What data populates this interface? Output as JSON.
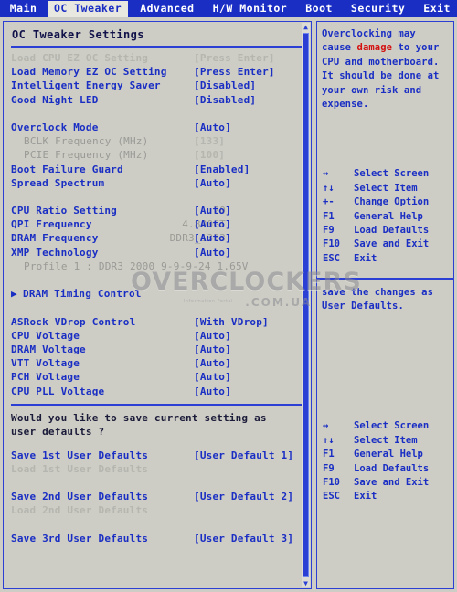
{
  "menu": {
    "tabs": [
      {
        "label": "Main",
        "active": false
      },
      {
        "label": "OC Tweaker",
        "active": true
      },
      {
        "label": "Advanced",
        "active": false
      },
      {
        "label": "H/W Monitor",
        "active": false
      },
      {
        "label": "Boot",
        "active": false
      },
      {
        "label": "Security",
        "active": false
      },
      {
        "label": "Exit",
        "active": false
      }
    ]
  },
  "panel": {
    "title": "OC Tweaker Settings",
    "question_line1": "Would you like to save current setting as",
    "question_line2": "user defaults ?"
  },
  "settings": [
    {
      "label": "Load CPU EZ OC Setting",
      "mid": "",
      "value": "[Press Enter]",
      "dim": true,
      "indent": false
    },
    {
      "label": "Load Memory EZ OC Setting",
      "mid": "",
      "value": "[Press Enter]",
      "dim": false,
      "indent": false
    },
    {
      "label": "Intelligent Energy Saver",
      "mid": "",
      "value": "[Disabled]",
      "dim": false,
      "indent": false
    },
    {
      "label": "Good Night LED",
      "mid": "",
      "value": "[Disabled]",
      "dim": false,
      "indent": false
    },
    {
      "gap": true
    },
    {
      "label": "Overclock Mode",
      "mid": "",
      "value": "[Auto]",
      "dim": false,
      "indent": false
    },
    {
      "label": "BCLK Frequency (MHz)",
      "mid": "",
      "value": "[133]",
      "dim": true,
      "indent": true
    },
    {
      "label": "PCIE Frequency (MHz)",
      "mid": "",
      "value": "[100]",
      "dim": true,
      "indent": true
    },
    {
      "label": "Boot Failure Guard",
      "mid": "",
      "value": "[Enabled]",
      "dim": false,
      "indent": false
    },
    {
      "label": "Spread Spectrum",
      "mid": "",
      "value": "[Auto]",
      "dim": false,
      "indent": false
    },
    {
      "gap": true
    },
    {
      "label": "CPU Ratio Setting",
      "mid": "20",
      "value": "[Auto]",
      "dim": false,
      "indent": false
    },
    {
      "label": "QPI Frequency",
      "mid": "4.800GT",
      "value": "[Auto]",
      "dim": false,
      "indent": false
    },
    {
      "label": "DRAM Frequency",
      "mid": "DDR3_1333",
      "value": "[Auto]",
      "dim": false,
      "indent": false
    },
    {
      "label": "XMP Technology",
      "mid": "",
      "value": "[Auto]",
      "dim": false,
      "indent": false
    },
    {
      "label": "Profile 1 : DDR3 2000 9-9-9-24 1.65V",
      "mid": "",
      "value": "",
      "dim": true,
      "indent": true
    },
    {
      "gap": true
    },
    {
      "label": "DRAM Timing Control",
      "mid": "",
      "value": "",
      "dim": false,
      "indent": false,
      "submenu": true
    },
    {
      "gap": true
    },
    {
      "label": "ASRock VDrop Control",
      "mid": "",
      "value": "[With VDrop]",
      "dim": false,
      "indent": false
    },
    {
      "label": "CPU Voltage",
      "mid": "",
      "value": "[Auto]",
      "dim": false,
      "indent": false
    },
    {
      "label": "DRAM Voltage",
      "mid": "",
      "value": "[Auto]",
      "dim": false,
      "indent": false
    },
    {
      "label": "VTT Voltage",
      "mid": "",
      "value": "[Auto]",
      "dim": false,
      "indent": false
    },
    {
      "label": "PCH Voltage",
      "mid": "",
      "value": "[Auto]",
      "dim": false,
      "indent": false
    },
    {
      "label": "CPU PLL Voltage",
      "mid": "",
      "value": "[Auto]",
      "dim": false,
      "indent": false
    }
  ],
  "defaults_rows": [
    {
      "label": "Save 1st User Defaults",
      "value": "[User Default  1]",
      "dim": false
    },
    {
      "label": "Load 1st User Defaults",
      "value": "",
      "dim": true
    },
    {
      "gap": true
    },
    {
      "label": "Save 2nd User Defaults",
      "value": "[User Default  2]",
      "dim": false
    },
    {
      "label": "Load 2nd User Defaults",
      "value": "",
      "dim": true
    },
    {
      "gap": true
    },
    {
      "label": "Save 3rd User Defaults",
      "value": "[User Default  3]",
      "dim": false
    }
  ],
  "help": {
    "warning_parts": [
      {
        "text": "Overclocking may cause ",
        "danger": false
      },
      {
        "text": "damage",
        "danger": true
      },
      {
        "text": " to your CPU and motherboard.",
        "danger": false
      },
      {
        "text": " It should be done at your own risk and expense.",
        "danger": false
      }
    ],
    "warning_plain": "Overclocking may cause damage to your CPU and motherboard. It should be done at your own risk and expense.",
    "item_help": "save the changes as User Defaults."
  },
  "legend_top": [
    {
      "key": "↔",
      "desc": "Select Screen"
    },
    {
      "key": "↑↓",
      "desc": "Select Item"
    },
    {
      "key": "+-",
      "desc": "Change Option"
    },
    {
      "key": "F1",
      "desc": "General Help"
    },
    {
      "key": "F9",
      "desc": "Load Defaults"
    },
    {
      "key": "F10",
      "desc": "Save and Exit"
    },
    {
      "key": "ESC",
      "desc": "Exit"
    }
  ],
  "legend_bottom": [
    {
      "key": "↔",
      "desc": "Select Screen"
    },
    {
      "key": "↑↓",
      "desc": "Select Item"
    },
    {
      "key": "F1",
      "desc": "General Help"
    },
    {
      "key": "F9",
      "desc": "Load Defaults"
    },
    {
      "key": "F10",
      "desc": "Save and Exit"
    },
    {
      "key": "ESC",
      "desc": "Exit"
    }
  ],
  "watermark": {
    "main": "OVERCLOCKERS",
    "sub": ".COM.UA",
    "tiny": "Information Portal"
  },
  "colors": {
    "accent_blue": "#1a2ec4",
    "border_blue": "#2b3fd4",
    "danger_red": "#d41010",
    "background": "#cdcdc5",
    "dim_text": "#b6b6b0",
    "title_text": "#12124a"
  }
}
